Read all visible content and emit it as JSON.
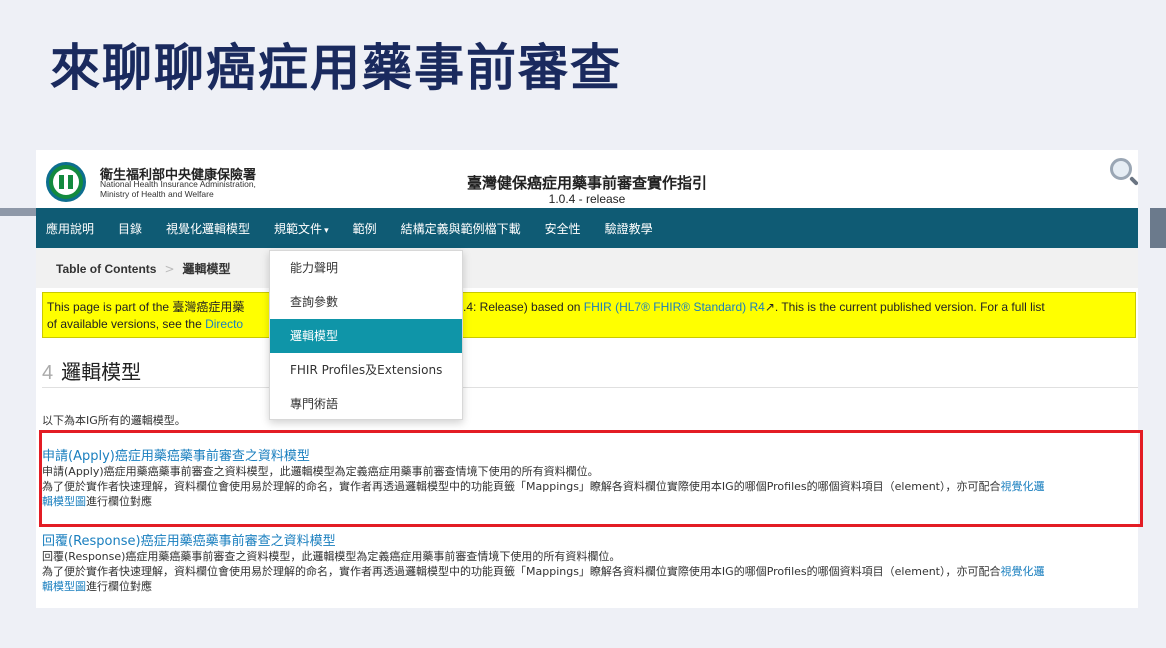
{
  "slide": {
    "title": "來聊聊癌症用藥事前審查"
  },
  "header": {
    "org_name_zh": "衛生福利部中央健康保險署",
    "org_name_en_1": "National Health Insurance Administration,",
    "org_name_en_2": "Ministry of Health and Welfare",
    "ig_title": "臺灣健保癌症用藥事前審查實作指引",
    "version": "1.0.4 - release"
  },
  "nav": {
    "items": [
      "應用說明",
      "目錄",
      "視覺化邏輯模型",
      "規範文件",
      "範例",
      "結構定義與範例檔下載",
      "安全性",
      "驗證教學"
    ],
    "caret": "▾"
  },
  "breadcrumb": {
    "toc": "Table of Contents",
    "sep": ">",
    "current": "邏輯模型"
  },
  "notice": {
    "pre": "This page is part of the 臺灣癌症用藥",
    "post_a": ".4: Release) based on ",
    "fhir_link": "FHIR (HL7® FHIR® Standard) R4",
    "post_b": ". This is the current published version. For a full list",
    "line2_a": "of available versions, see the ",
    "directory_link": "Directo"
  },
  "section": {
    "number": "4",
    "title": "邏輯模型"
  },
  "intro": "以下為本IG所有的邏輯模型。",
  "blocks": [
    {
      "heading": "申請(Apply)癌症用藥癌藥事前審查之資料模型",
      "line1": "申請(Apply)癌症用藥癌藥事前審查之資料模型，此邏輯模型為定義癌症用藥事前審查情境下使用的所有資料欄位。",
      "line2a": "為了便於實作者快速理解，資料欄位會使用易於理解的命名，實作者再透過邏輯模型中的功能頁籤「Mappings」瞭解各資料欄位實際使用本IG的哪個Profiles的哪個資料項目（element），亦可配合",
      "link1": "視覺化邏",
      "link2": "輯模型圖",
      "line2b": "進行欄位對應"
    },
    {
      "heading": "回覆(Response)癌症用藥癌藥事前審查之資料模型",
      "line1": "回覆(Response)癌症用藥癌藥事前審查之資料模型，此邏輯模型為定義癌症用藥事前審查情境下使用的所有資料欄位。",
      "line2a": "為了便於實作者快速理解，資料欄位會使用易於理解的命名，實作者再透過邏輯模型中的功能頁籤「Mappings」瞭解各資料欄位實際使用本IG的哪個Profiles的哪個資料項目（element），亦可配合",
      "link1": "視覺化邏",
      "link2": "輯模型圖",
      "line2b": "進行欄位對應"
    }
  ],
  "dropdown": {
    "items": [
      "能力聲明",
      "查詢參數",
      "邏輯模型",
      "FHIR Profiles及Extensions",
      "專門術語"
    ],
    "active_index": 2
  },
  "colors": {
    "nav": "#0f5b74",
    "active": "#0f95a8",
    "highlight": "#e31c24",
    "notice": "#ffff00",
    "title": "#1a2a5e"
  }
}
